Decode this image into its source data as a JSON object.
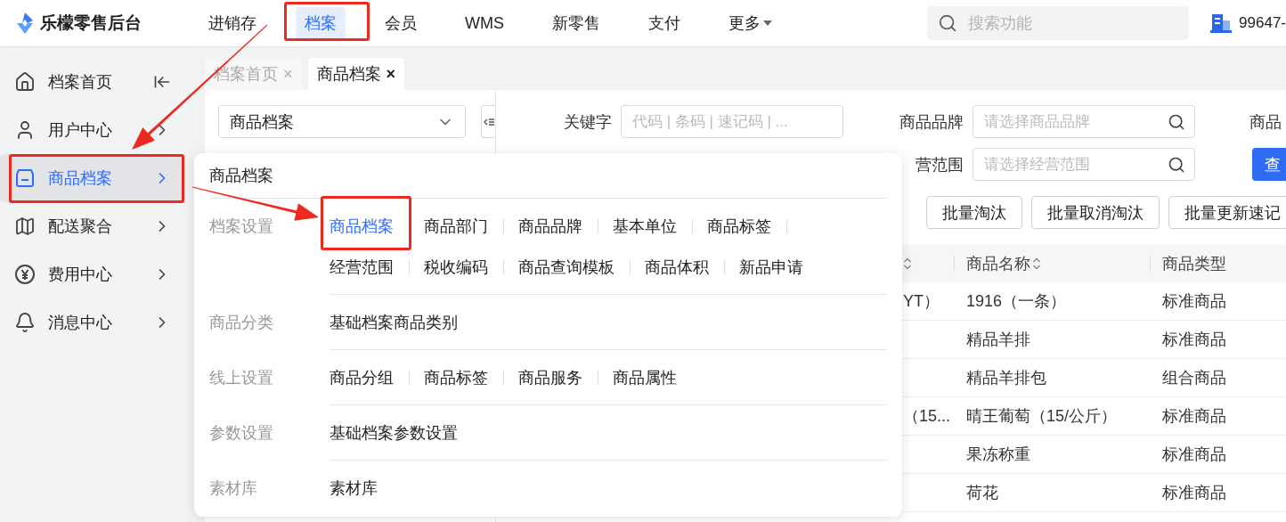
{
  "app": {
    "name": "乐檬零售后台"
  },
  "top_nav": [
    {
      "label": "进销存",
      "kind": "link",
      "selected": false,
      "highlighted": false
    },
    {
      "label": "档案",
      "kind": "link",
      "selected": true,
      "highlighted": true
    },
    {
      "label": "会员",
      "kind": "link",
      "selected": false,
      "highlighted": false
    },
    {
      "label": "WMS",
      "kind": "link",
      "selected": false,
      "highlighted": false
    },
    {
      "label": "新零售",
      "kind": "link",
      "selected": false,
      "highlighted": false
    },
    {
      "label": "支付",
      "kind": "link",
      "selected": false,
      "highlighted": false
    },
    {
      "label": "更多",
      "kind": "menu",
      "selected": false,
      "highlighted": false
    }
  ],
  "search": {
    "placeholder": "搜索功能"
  },
  "account": {
    "label": "99647-"
  },
  "sidebar": {
    "items": [
      {
        "label": "档案首页",
        "kind": "home",
        "selected": false,
        "highlighted": false
      },
      {
        "label": "用户中心",
        "kind": "group",
        "selected": false,
        "highlighted": false
      },
      {
        "label": "商品档案",
        "kind": "group",
        "selected": true,
        "highlighted": true
      },
      {
        "label": "配送聚合",
        "kind": "group",
        "selected": false,
        "highlighted": false
      },
      {
        "label": "费用中心",
        "kind": "group",
        "selected": false,
        "highlighted": false
      },
      {
        "label": "消息中心",
        "kind": "group",
        "selected": false,
        "highlighted": false
      }
    ]
  },
  "tabs": [
    {
      "label": "档案首页",
      "close": "×",
      "selected": false
    },
    {
      "label": "商品档案",
      "close": "×",
      "selected": true
    }
  ],
  "tree_panel": {
    "select_value": "商品档案"
  },
  "filters": {
    "keyword": {
      "label": "关键字",
      "placeholder": "代码 | 条码 | 速记码 | ..."
    },
    "brand": {
      "label": "商品品牌",
      "placeholder": "请选择商品品牌"
    },
    "scope": {
      "label": "营范围",
      "placeholder": "请选择经营范围"
    },
    "column_3_label": "商品",
    "query_button": "查"
  },
  "actions": [
    "批量淘汰",
    "批量取消淘汰",
    "批量更新速记"
  ],
  "table": {
    "columns": [
      {
        "label": "商品名称",
        "sortable": true
      },
      {
        "label": "商品类型",
        "sortable": false
      }
    ],
    "rows": [
      {
        "column_1": "YT）",
        "name": "1916（一条）",
        "type": "标准商品"
      },
      {
        "name": "精品羊排",
        "type": "标准商品"
      },
      {
        "name": "精品羊排包",
        "type": "组合商品"
      },
      {
        "column_1": "（15...",
        "name": "晴王葡萄（15/公斤）",
        "type": "标准商品"
      },
      {
        "name": "果冻称重",
        "type": "标准商品"
      },
      {
        "name": "荷花",
        "type": "标准商品"
      }
    ]
  },
  "menu_popup": {
    "title": "商品档案",
    "sections": [
      {
        "label": "档案设置",
        "links": [
          {
            "label": "商品档案",
            "selected": true,
            "highlighted": true
          },
          {
            "label": "商品部门",
            "selected": false,
            "highlighted": false
          },
          {
            "label": "商品品牌",
            "selected": false,
            "highlighted": false
          },
          {
            "label": "基本单位",
            "selected": false,
            "highlighted": false
          },
          {
            "label": "商品标签",
            "selected": false,
            "highlighted": false
          },
          {
            "label": "经营范围",
            "selected": false,
            "highlighted": false
          },
          {
            "label": "税收编码",
            "selected": false,
            "highlighted": false
          },
          {
            "label": "商品查询模板",
            "selected": false,
            "highlighted": false
          },
          {
            "label": "商品体积",
            "selected": false,
            "highlighted": false
          },
          {
            "label": "新品申请",
            "selected": false,
            "highlighted": false
          }
        ]
      },
      {
        "label": "商品分类",
        "links": [
          {
            "label": "基础档案商品类别",
            "selected": false,
            "highlighted": false
          }
        ]
      },
      {
        "label": "线上设置",
        "links": [
          {
            "label": "商品分组",
            "selected": false,
            "highlighted": false
          },
          {
            "label": "商品标签",
            "selected": false,
            "highlighted": false
          },
          {
            "label": "商品服务",
            "selected": false,
            "highlighted": false
          },
          {
            "label": "商品属性",
            "selected": false,
            "highlighted": false
          }
        ]
      },
      {
        "label": "参数设置",
        "links": [
          {
            "label": "基础档案参数设置",
            "selected": false,
            "highlighted": false
          }
        ]
      },
      {
        "label": "素材库",
        "links": [
          {
            "label": "素材库",
            "selected": false,
            "highlighted": false
          }
        ]
      }
    ]
  }
}
